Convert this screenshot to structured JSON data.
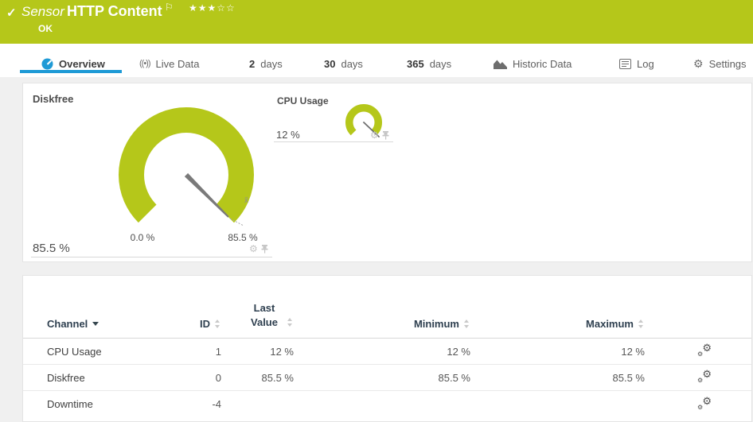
{
  "icons": {
    "check": "✓",
    "flag": "⚐",
    "stars_filled": "★★★",
    "stars_empty": "☆☆",
    "gear": "⚙",
    "broadcast": "((•))",
    "mean_marker": "x̄"
  },
  "colors": {
    "status_ok_green": "#b5c71a",
    "active_tab_blue": "#1e9ad6",
    "gauge_green": "#b5c71a"
  },
  "header": {
    "kind": "Sensor",
    "name": "HTTP Content",
    "status": "OK",
    "rating": "3 of 5 stars"
  },
  "tabs": {
    "overview": "Overview",
    "live_data": "Live Data",
    "days2_num": "2",
    "days2_unit": "days",
    "days30_num": "30",
    "days30_unit": "days",
    "days365_num": "365",
    "days365_unit": "days",
    "historic": "Historic Data",
    "log": "Log",
    "settings": "Settings"
  },
  "gauges": {
    "diskfree": {
      "title": "Diskfree",
      "current_value": "85.5 %",
      "scale_min": "0.0 %",
      "scale_max": "85.5 %",
      "value_percent_of_scale": 100
    },
    "cpu": {
      "title": "CPU Usage",
      "current_value": "12 %",
      "value_percent_of_scale": 100
    }
  },
  "channel_table": {
    "headers": {
      "channel": "Channel",
      "id": "ID",
      "last_value": "Last Value",
      "minimum": "Minimum",
      "maximum": "Maximum"
    },
    "rows": [
      {
        "channel": "CPU Usage",
        "id": "1",
        "last_value": "12 %",
        "minimum": "12 %",
        "maximum": "12 %"
      },
      {
        "channel": "Diskfree",
        "id": "0",
        "last_value": "85.5 %",
        "minimum": "85.5 %",
        "maximum": "85.5 %"
      },
      {
        "channel": "Downtime",
        "id": "-4",
        "last_value": "",
        "minimum": "",
        "maximum": ""
      }
    ]
  }
}
